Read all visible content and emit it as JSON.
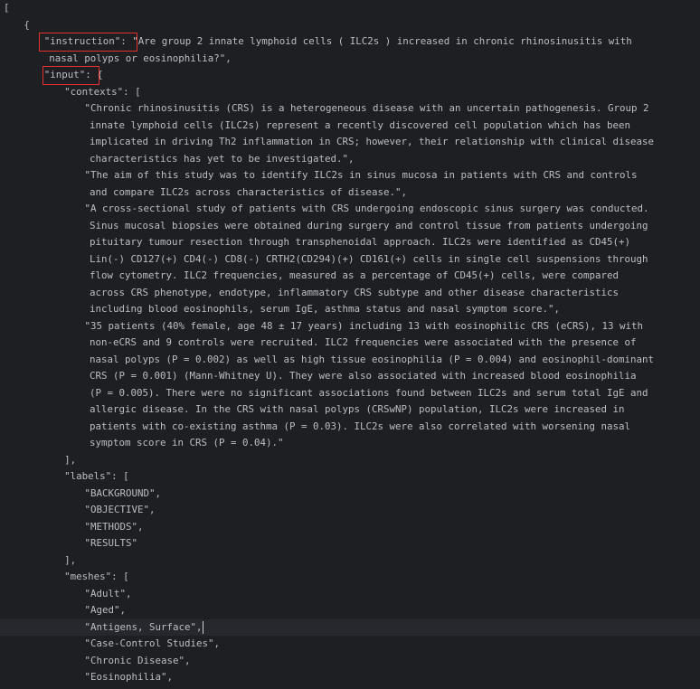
{
  "editor": {
    "lines": [
      {
        "indent": 0,
        "text": "["
      },
      {
        "indent": 4,
        "text": "{"
      },
      {
        "indent": 8,
        "text": "\"instruction\": \"Are group 2 innate lymphoid cells ( ILC2s ) increased in chronic rhinosinusitis with"
      },
      {
        "indent": 9,
        "text": "nasal polyps or eosinophilia?\","
      },
      {
        "indent": 8,
        "text": "\"input\": {"
      },
      {
        "indent": 12,
        "text": "\"contexts\": ["
      },
      {
        "indent": 16,
        "text": "\"Chronic rhinosinusitis (CRS) is a heterogeneous disease with an uncertain pathogenesis. Group 2"
      },
      {
        "indent": 17,
        "text": "innate lymphoid cells (ILC2s) represent a recently discovered cell population which has been"
      },
      {
        "indent": 17,
        "text": "implicated in driving Th2 inflammation in CRS; however, their relationship with clinical disease"
      },
      {
        "indent": 17,
        "text": "characteristics has yet to be investigated.\","
      },
      {
        "indent": 16,
        "text": "\"The aim of this study was to identify ILC2s in sinus mucosa in patients with CRS and controls"
      },
      {
        "indent": 17,
        "text": "and compare ILC2s across characteristics of disease.\","
      },
      {
        "indent": 16,
        "text": "\"A cross-sectional study of patients with CRS undergoing endoscopic sinus surgery was conducted."
      },
      {
        "indent": 17,
        "text": "Sinus mucosal biopsies were obtained during surgery and control tissue from patients undergoing"
      },
      {
        "indent": 17,
        "text": "pituitary tumour resection through transphenoidal approach. ILC2s were identified as CD45(+)"
      },
      {
        "indent": 17,
        "text": "Lin(-) CD127(+) CD4(-) CD8(-) CRTH2(CD294)(+) CD161(+) cells in single cell suspensions through"
      },
      {
        "indent": 17,
        "text": "flow cytometry. ILC2 frequencies, measured as a percentage of CD45(+) cells, were compared"
      },
      {
        "indent": 17,
        "text": "across CRS phenotype, endotype, inflammatory CRS subtype and other disease characteristics"
      },
      {
        "indent": 17,
        "text": "including blood eosinophils, serum IgE, asthma status and nasal symptom score.\","
      },
      {
        "indent": 16,
        "text": "\"35 patients (40% female, age 48 ± 17 years) including 13 with eosinophilic CRS (eCRS), 13 with"
      },
      {
        "indent": 17,
        "text": "non-eCRS and 9 controls were recruited. ILC2 frequencies were associated with the presence of"
      },
      {
        "indent": 17,
        "text": "nasal polyps (P = 0.002) as well as high tissue eosinophilia (P = 0.004) and eosinophil-dominant"
      },
      {
        "indent": 17,
        "text": "CRS (P = 0.001) (Mann-Whitney U). They were also associated with increased blood eosinophilia"
      },
      {
        "indent": 17,
        "text": "(P = 0.005). There were no significant associations found between ILC2s and serum total IgE and"
      },
      {
        "indent": 17,
        "text": "allergic disease. In the CRS with nasal polyps (CRSwNP) population, ILC2s were increased in"
      },
      {
        "indent": 17,
        "text": "patients with co-existing asthma (P = 0.03). ILC2s were also correlated with worsening nasal"
      },
      {
        "indent": 17,
        "text": "symptom score in CRS (P = 0.04).\""
      },
      {
        "indent": 12,
        "text": "],"
      },
      {
        "indent": 12,
        "text": "\"labels\": ["
      },
      {
        "indent": 16,
        "text": "\"BACKGROUND\","
      },
      {
        "indent": 16,
        "text": "\"OBJECTIVE\","
      },
      {
        "indent": 16,
        "text": "\"METHODS\","
      },
      {
        "indent": 16,
        "text": "\"RESULTS\""
      },
      {
        "indent": 12,
        "text": "],"
      },
      {
        "indent": 12,
        "text": "\"meshes\": ["
      },
      {
        "indent": 16,
        "text": "\"Adult\","
      },
      {
        "indent": 16,
        "text": "\"Aged\","
      },
      {
        "indent": 16,
        "text": "\"Antigens, Surface\","
      },
      {
        "indent": 16,
        "text": "\"Case-Control Studies\","
      },
      {
        "indent": 16,
        "text": "\"Chronic Disease\","
      },
      {
        "indent": 16,
        "text": "\"Eosinophilia\","
      }
    ],
    "current_line": 37
  },
  "colors": {
    "background": "#1e1f22",
    "text": "#bcbec4",
    "current_line": "#26282e",
    "highlight_box": "#e03131"
  }
}
